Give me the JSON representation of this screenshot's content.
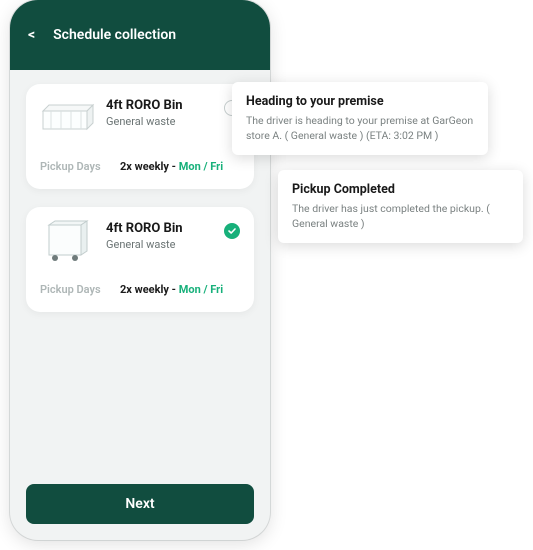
{
  "header": {
    "back_glyph": "<",
    "title": "Schedule collection"
  },
  "cards": [
    {
      "title": "4ft RORO Bin",
      "subtitle": "General waste",
      "selected": false,
      "pickup_label": "Pickup Days",
      "freq": "2x weekly - ",
      "days": "Mon / Fri"
    },
    {
      "title": "4ft RORO Bin",
      "subtitle": "General waste",
      "selected": true,
      "pickup_label": "Pickup Days",
      "freq": "2x weekly - ",
      "days": "Mon / Fri"
    }
  ],
  "next_label": "Next",
  "notifications": [
    {
      "title": "Heading to your premise",
      "body": "The driver is heading to your premise at GarGeon store A. ( General waste ) (ETA: 3:02 PM )"
    },
    {
      "title": "Pickup Completed",
      "body": "The driver has just completed the pickup. ( General waste )"
    }
  ]
}
